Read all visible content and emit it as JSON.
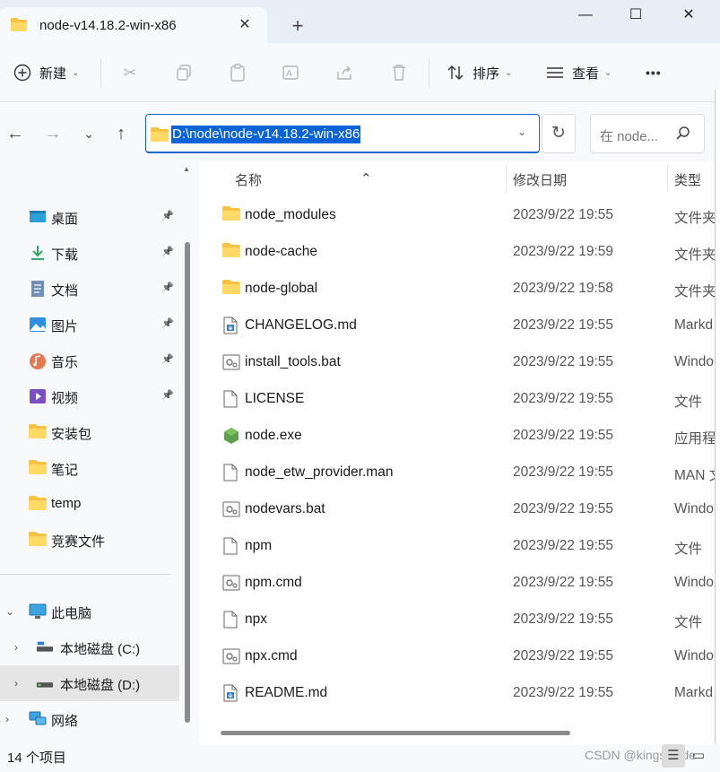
{
  "tab": {
    "title": "node-v14.18.2-win-x86",
    "close": "✕",
    "new_tab": "+"
  },
  "window": {
    "minimize": "—",
    "maximize": "☐",
    "close": "✕"
  },
  "toolbar": {
    "new_label": "新建",
    "sort_label": "排序",
    "view_label": "查看",
    "more": "•••"
  },
  "address": {
    "path": "D:\\node\\node-v14.18.2-win-x86",
    "search_placeholder": "在 node..."
  },
  "sidebar": {
    "quick": [
      {
        "label": "桌面",
        "icon": "desktop-icon",
        "pinned": true
      },
      {
        "label": "下载",
        "icon": "download-icon",
        "pinned": true
      },
      {
        "label": "文档",
        "icon": "document-icon",
        "pinned": true
      },
      {
        "label": "图片",
        "icon": "picture-icon",
        "pinned": true
      },
      {
        "label": "音乐",
        "icon": "music-icon",
        "pinned": true
      },
      {
        "label": "视频",
        "icon": "video-icon",
        "pinned": true
      },
      {
        "label": "安装包",
        "icon": "folder-icon",
        "pinned": false
      },
      {
        "label": "笔记",
        "icon": "folder-icon",
        "pinned": false
      },
      {
        "label": "temp",
        "icon": "folder-icon",
        "pinned": false
      },
      {
        "label": "竞赛文件",
        "icon": "folder-icon",
        "pinned": false
      }
    ],
    "this_pc": "此电脑",
    "drive_c": "本地磁盘 (C:)",
    "drive_d": "本地磁盘 (D:)",
    "network": "网络"
  },
  "columns": {
    "name": "名称",
    "date": "修改日期",
    "type": "类型"
  },
  "files": [
    {
      "name": "node_modules",
      "date": "2023/9/22 19:55",
      "type": "文件夹",
      "icon": "folder-icon"
    },
    {
      "name": "node-cache",
      "date": "2023/9/22 19:59",
      "type": "文件夹",
      "icon": "folder-icon"
    },
    {
      "name": "node-global",
      "date": "2023/9/22 19:58",
      "type": "文件夹",
      "icon": "folder-icon"
    },
    {
      "name": "CHANGELOG.md",
      "date": "2023/9/22 19:55",
      "type": "Markd",
      "icon": "markdown-file-icon"
    },
    {
      "name": "install_tools.bat",
      "date": "2023/9/22 19:55",
      "type": "Windo",
      "icon": "batch-file-icon"
    },
    {
      "name": "LICENSE",
      "date": "2023/9/22 19:55",
      "type": "文件",
      "icon": "file-icon"
    },
    {
      "name": "node.exe",
      "date": "2023/9/22 19:55",
      "type": "应用程",
      "icon": "nodejs-icon"
    },
    {
      "name": "node_etw_provider.man",
      "date": "2023/9/22 19:55",
      "type": "MAN 文",
      "icon": "file-icon"
    },
    {
      "name": "nodevars.bat",
      "date": "2023/9/22 19:55",
      "type": "Windo",
      "icon": "batch-file-icon"
    },
    {
      "name": "npm",
      "date": "2023/9/22 19:55",
      "type": "文件",
      "icon": "file-icon"
    },
    {
      "name": "npm.cmd",
      "date": "2023/9/22 19:55",
      "type": "Windo",
      "icon": "batch-file-icon"
    },
    {
      "name": "npx",
      "date": "2023/9/22 19:55",
      "type": "文件",
      "icon": "file-icon"
    },
    {
      "name": "npx.cmd",
      "date": "2023/9/22 19:55",
      "type": "Windo",
      "icon": "batch-file-icon"
    },
    {
      "name": "README.md",
      "date": "2023/9/22 19:55",
      "type": "Markd",
      "icon": "markdown-file-icon"
    }
  ],
  "status": {
    "count": "14 个项目"
  },
  "watermark": "CSDN @kingsCode"
}
